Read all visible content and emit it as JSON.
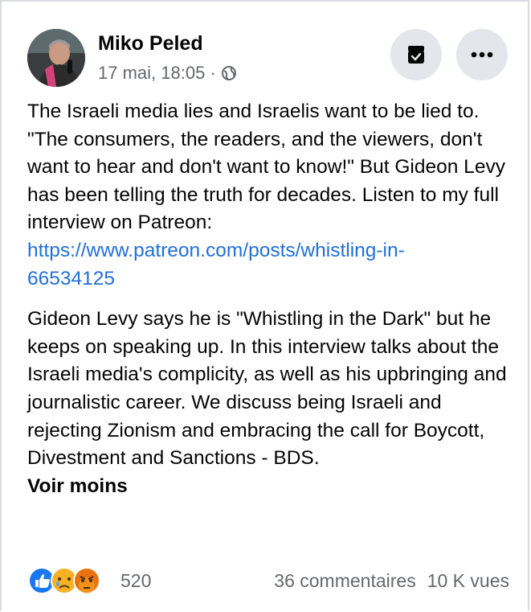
{
  "post": {
    "author": "Miko Peled",
    "timestamp": "17 mai, 18:05 ·",
    "paragraph1": "The Israeli media lies and Israelis want to be lied to. \"The consumers, the readers, and the viewers, don't want to hear and don't want to know!\" But Gideon Levy has been telling the truth for decades. Listen to my full interview on Patreon:",
    "link": "https://www.patreon.com/posts/whistling-in-66534125",
    "link_line1": "https://www.patreon.com/posts/whistling-in-",
    "link_line2": "66534125",
    "paragraph2": "Gideon Levy says he is \"Whistling in the Dark\" but he keeps on speaking up. In this interview talks about the Israeli media's complicity, as well as his upbringing and journalistic career. We discuss being Israeli and rejecting Zionism and embracing the call for Boycott, Divestment and Sanctions - BDS.",
    "see_less": "Voir moins"
  },
  "footer": {
    "reactions": [
      "like",
      "sad",
      "angry"
    ],
    "reaction_count": "520",
    "comments": "36 commentaires",
    "views": "10 K vues"
  },
  "icons": {
    "save": "save-icon",
    "more": "more-options-icon",
    "privacy": "globe-icon"
  },
  "colors": {
    "link": "#216fdb",
    "secondary_text": "#65676b",
    "button_bg": "#e4e6eb",
    "like_blue": "#1877f2",
    "angry_red": "#e9710f"
  }
}
